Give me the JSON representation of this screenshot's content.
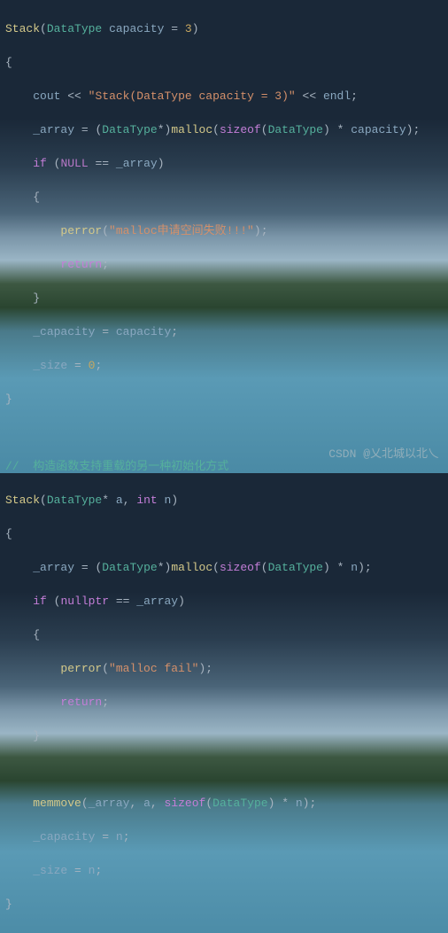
{
  "watermark": "CSDN @乂北城以北乀",
  "code": {
    "l1": {
      "fn": "Stack",
      "type": "DataType",
      "id": "capacity",
      "eq": "=",
      "num": "3"
    },
    "l2": "{",
    "l3": {
      "ws": "    ",
      "cout": "cout",
      "ins": "<<",
      "s": "\"Stack(DataType capacity = 3)\"",
      "endl": "endl"
    },
    "l4": {
      "ws": "    ",
      "arr": "_array",
      "eq": "=",
      "type": "DataType",
      "fn": "malloc",
      "sz": "sizeof",
      "mul": "*",
      "cap": "capacity"
    },
    "l5": {
      "ws": "    ",
      "kw": "if",
      "null": "NULL",
      "eq": "==",
      "arr": "_array"
    },
    "l6": {
      "ws": "    ",
      "b": "{"
    },
    "l7": {
      "ws": "        ",
      "fn": "perror",
      "s": "\"malloc申请空间失败!!!\""
    },
    "l8": {
      "ws": "        ",
      "kw": "return"
    },
    "l9": {
      "ws": "    ",
      "b": "}"
    },
    "l10": {
      "ws": "    ",
      "cap": "_capacity",
      "eq": "=",
      "cap2": "capacity"
    },
    "l11": {
      "ws": "    ",
      "sz": "_size",
      "eq": "=",
      "num": "0"
    },
    "l12": "}",
    "l14": {
      "c": "//  构造函数支持重载的另一种初始化方式"
    },
    "l15": {
      "fn": "Stack",
      "type": "DataType",
      "a": "a",
      "kw": "int",
      "n": "n"
    },
    "l16": "{",
    "l17": {
      "ws": "    ",
      "arr": "_array",
      "eq": "=",
      "type": "DataType",
      "fn": "malloc",
      "sz": "sizeof",
      "mul": "*",
      "n": "n"
    },
    "l18": {
      "ws": "    ",
      "kw": "if",
      "null": "nullptr",
      "eq": "==",
      "arr": "_array"
    },
    "l19": {
      "ws": "    ",
      "b": "{"
    },
    "l20": {
      "ws": "        ",
      "fn": "perror",
      "s": "\"malloc fail\""
    },
    "l21": {
      "ws": "        ",
      "kw": "return"
    },
    "l22": {
      "ws": "    ",
      "b": "}"
    },
    "l24": {
      "ws": "    ",
      "fn": "memmove",
      "arr": "_array",
      "a": "a",
      "sz": "sizeof",
      "type": "DataType",
      "mul": "*",
      "n": "n"
    },
    "l25": {
      "ws": "    ",
      "cap": "_capacity",
      "eq": "=",
      "n": "n"
    },
    "l26": {
      "ws": "    ",
      "sz": "_size",
      "eq": "=",
      "n": "n"
    },
    "l27": "}"
  }
}
